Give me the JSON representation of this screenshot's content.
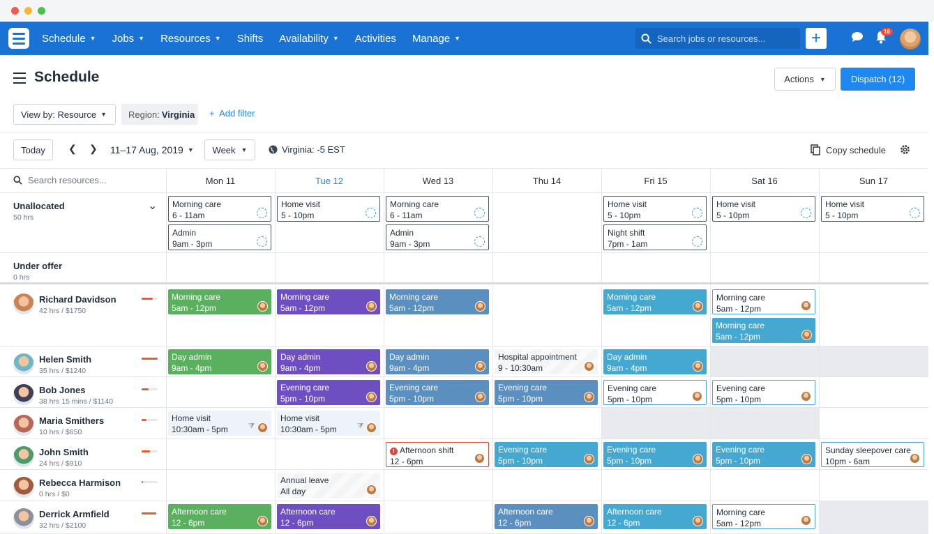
{
  "colors": {
    "nav": "#1a73d4",
    "primary": "#1e87f0",
    "green": "#5bb05f",
    "purple": "#6d4fc2",
    "steel": "#5b8fc0",
    "teal": "#45a8d1",
    "alert": "#e0473a",
    "workload": "#f05a28"
  },
  "nav": {
    "items": [
      {
        "label": "Schedule",
        "dropdown": true
      },
      {
        "label": "Jobs",
        "dropdown": true
      },
      {
        "label": "Resources",
        "dropdown": true
      },
      {
        "label": "Shifts",
        "dropdown": false
      },
      {
        "label": "Availability",
        "dropdown": true
      },
      {
        "label": "Activities",
        "dropdown": false
      },
      {
        "label": "Manage",
        "dropdown": true
      }
    ],
    "search_placeholder": "Search jobs or resources...",
    "notification_count": "16"
  },
  "header": {
    "title": "Schedule",
    "actions_label": "Actions",
    "dispatch_label": "Dispatch (12)"
  },
  "filters": {
    "view_by": "View by: Resource",
    "region_label": "Region:",
    "region_value": "Virginia",
    "add_filter": "Add filter"
  },
  "toolbar": {
    "today": "Today",
    "range": "11–17 Aug, 2019",
    "period": "Week",
    "timezone": "Virginia: -5 EST",
    "copy": "Copy schedule"
  },
  "grid": {
    "search_placeholder": "Search resources...",
    "days": [
      {
        "label": "Mon 11",
        "today": false
      },
      {
        "label": "Tue 12",
        "today": true
      },
      {
        "label": "Wed 13",
        "today": false
      },
      {
        "label": "Thu 14",
        "today": false
      },
      {
        "label": "Fri 15",
        "today": false
      },
      {
        "label": "Sat 16",
        "today": false
      },
      {
        "label": "Sun 17",
        "today": false
      }
    ],
    "sections": [
      {
        "name": "Unallocated",
        "meta": "50 hrs"
      },
      {
        "name": "Under offer",
        "meta": "0 hrs"
      }
    ],
    "resources": [
      {
        "name": "Richard Davidson",
        "meta": "42 hrs / $1750",
        "workload": 0.7
      },
      {
        "name": "Helen Smith",
        "meta": "35 hrs / $1240",
        "workload": 1.0
      },
      {
        "name": "Bob Jones",
        "meta": "38 hrs 15 mins / $1140",
        "workload": 0.45
      },
      {
        "name": "Maria Smithers",
        "meta": "10 hrs / $650",
        "workload": 0.3
      },
      {
        "name": "John Smith",
        "meta": "24 hrs / $910",
        "workload": 0.5
      },
      {
        "name": "Rebecca Harmison",
        "meta": "0 hrs / $0",
        "workload": 0.1
      },
      {
        "name": "Derrick Armfield",
        "meta": "32 hrs / $2100",
        "workload": 0.9
      }
    ],
    "shifts": [
      {
        "row": "unalloc",
        "day": 0,
        "slot": 0,
        "style": "unalloc",
        "title": "Morning care",
        "time": "6 - 11am"
      },
      {
        "row": "unalloc",
        "day": 0,
        "slot": 1,
        "style": "unalloc",
        "title": "Admin",
        "time": "9am - 3pm"
      },
      {
        "row": "unalloc",
        "day": 1,
        "slot": 0,
        "style": "unalloc",
        "title": "Home visit",
        "time": "5 - 10pm"
      },
      {
        "row": "unalloc",
        "day": 2,
        "slot": 0,
        "style": "unalloc",
        "title": "Morning care",
        "time": "6 - 11am"
      },
      {
        "row": "unalloc",
        "day": 2,
        "slot": 1,
        "style": "unalloc",
        "title": "Admin",
        "time": "9am - 3pm"
      },
      {
        "row": "unalloc",
        "day": 4,
        "slot": 0,
        "style": "unalloc",
        "title": "Home visit",
        "time": "5 - 10pm"
      },
      {
        "row": "unalloc",
        "day": 4,
        "slot": 1,
        "style": "unalloc",
        "title": "Night shift",
        "time": "7pm - 1am"
      },
      {
        "row": "unalloc",
        "day": 5,
        "slot": 0,
        "style": "unalloc",
        "title": "Home visit",
        "time": "5 - 10pm"
      },
      {
        "row": "unalloc",
        "day": 6,
        "slot": 0,
        "style": "unalloc",
        "title": "Home visit",
        "time": "5 - 10pm"
      },
      {
        "row": 0,
        "day": 0,
        "slot": 0,
        "style": "green",
        "title": "Morning care",
        "time": "5am - 12pm"
      },
      {
        "row": 0,
        "day": 1,
        "slot": 0,
        "style": "purple",
        "title": "Morning care",
        "time": "5am - 12pm"
      },
      {
        "row": 0,
        "day": 2,
        "slot": 0,
        "style": "steel",
        "title": "Morning care",
        "time": "5am - 12pm"
      },
      {
        "row": 0,
        "day": 4,
        "slot": 0,
        "style": "teal",
        "title": "Morning care",
        "time": "5am - 12pm"
      },
      {
        "row": 0,
        "day": 5,
        "slot": 0,
        "style": "outline",
        "title": "Morning care",
        "time": "5am - 12pm"
      },
      {
        "row": 0,
        "day": 5,
        "slot": 1,
        "style": "teal",
        "title": "Morning care",
        "time": "5am - 12pm"
      },
      {
        "row": 1,
        "day": 0,
        "slot": 0,
        "style": "green",
        "title": "Day admin",
        "time": "9am - 4pm"
      },
      {
        "row": 1,
        "day": 1,
        "slot": 0,
        "style": "purple",
        "title": "Day admin",
        "time": "9am - 4pm"
      },
      {
        "row": 1,
        "day": 2,
        "slot": 0,
        "style": "steel",
        "title": "Day admin",
        "time": "9am - 4pm"
      },
      {
        "row": 1,
        "day": 3,
        "slot": 0,
        "style": "stripe",
        "title": "Hospital appointment",
        "time": "9 - 10:30am"
      },
      {
        "row": 1,
        "day": 4,
        "slot": 0,
        "style": "teal",
        "title": "Day admin",
        "time": "9am - 4pm"
      },
      {
        "row": 2,
        "day": 1,
        "slot": 0,
        "style": "purple",
        "title": "Evening care",
        "time": "5pm - 10pm"
      },
      {
        "row": 2,
        "day": 2,
        "slot": 0,
        "style": "steel",
        "title": "Evening care",
        "time": "5pm - 10pm"
      },
      {
        "row": 2,
        "day": 3,
        "slot": 0,
        "style": "steel",
        "title": "Evening care",
        "time": "5pm - 10pm"
      },
      {
        "row": 2,
        "day": 4,
        "slot": 0,
        "style": "outline",
        "title": "Evening care",
        "time": "5pm - 10pm"
      },
      {
        "row": 2,
        "day": 5,
        "slot": 0,
        "style": "outline",
        "title": "Evening care",
        "time": "5pm - 10pm"
      },
      {
        "row": 3,
        "day": 0,
        "slot": 0,
        "style": "pale",
        "title": "Home visit",
        "time": "10:30am - 5pm",
        "filter": true
      },
      {
        "row": 3,
        "day": 1,
        "slot": 0,
        "style": "pale",
        "title": "Home visit",
        "time": "10:30am - 5pm",
        "filter": true
      },
      {
        "row": 4,
        "day": 2,
        "slot": 0,
        "style": "alert",
        "title": "Afternoon shift",
        "time": "12 - 6pm",
        "alert": true
      },
      {
        "row": 4,
        "day": 3,
        "slot": 0,
        "style": "teal",
        "title": "Evening care",
        "time": "5pm - 10pm"
      },
      {
        "row": 4,
        "day": 4,
        "slot": 0,
        "style": "teal",
        "title": "Evening care",
        "time": "5pm - 10pm"
      },
      {
        "row": 4,
        "day": 5,
        "slot": 0,
        "style": "teal",
        "title": "Evening care",
        "time": "5pm - 10pm"
      },
      {
        "row": 4,
        "day": 6,
        "slot": 0,
        "style": "outline",
        "title": "Sunday sleepover care",
        "time": "10pm - 6am"
      },
      {
        "row": 5,
        "day": 1,
        "slot": 0,
        "style": "stripe",
        "title": "Annual leave",
        "time": "All day"
      },
      {
        "row": 6,
        "day": 0,
        "slot": 0,
        "style": "green",
        "title": "Afternoon care",
        "time": "12 - 6pm"
      },
      {
        "row": 6,
        "day": 1,
        "slot": 0,
        "style": "purple",
        "title": "Afternoon care",
        "time": "12 - 6pm"
      },
      {
        "row": 6,
        "day": 3,
        "slot": 0,
        "style": "steel",
        "title": "Afternoon care",
        "time": "12 - 6pm"
      },
      {
        "row": 6,
        "day": 4,
        "slot": 0,
        "style": "teal",
        "title": "Afternoon care",
        "time": "12 - 6pm"
      },
      {
        "row": 6,
        "day": 5,
        "slot": 0,
        "style": "outline",
        "title": "Morning care",
        "time": "5am - 12pm"
      }
    ],
    "unavailable": [
      {
        "row": 1,
        "day": 5
      },
      {
        "row": 1,
        "day": 6
      },
      {
        "row": 3,
        "day": 4
      },
      {
        "row": 3,
        "day": 5
      },
      {
        "row": 6,
        "day": 6
      }
    ]
  }
}
